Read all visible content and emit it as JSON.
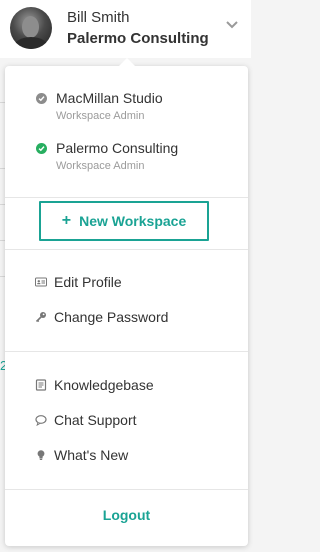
{
  "colors": {
    "accent": "#1aa394",
    "check_inactive": "#8c8c8c",
    "check_active": "#27ae60",
    "muted_text": "#9b9b9b"
  },
  "header": {
    "user_name": "Bill Smith",
    "org_name": "Palermo Consulting",
    "avatar_icon": "user-avatar",
    "toggle_icon": "chevron-down-icon"
  },
  "workspaces": [
    {
      "name": "MacMillan Studio",
      "role": "Workspace Admin",
      "active": false,
      "icon": "check-circle-icon"
    },
    {
      "name": "Palermo Consulting",
      "role": "Workspace Admin",
      "active": true,
      "icon": "check-circle-icon"
    }
  ],
  "new_workspace": {
    "icon": "plus",
    "label": "New Workspace"
  },
  "account_menu": [
    {
      "label": "Edit Profile",
      "icon": "id-card-icon"
    },
    {
      "label": "Change Password",
      "icon": "key-icon"
    }
  ],
  "help_menu": [
    {
      "label": "Knowledgebase",
      "icon": "book-icon"
    },
    {
      "label": "Chat Support",
      "icon": "chat-bubble-icon"
    },
    {
      "label": "What's New",
      "icon": "lightbulb-icon"
    }
  ],
  "logout_label": "Logout",
  "background": {
    "partial_glyph": "2"
  }
}
